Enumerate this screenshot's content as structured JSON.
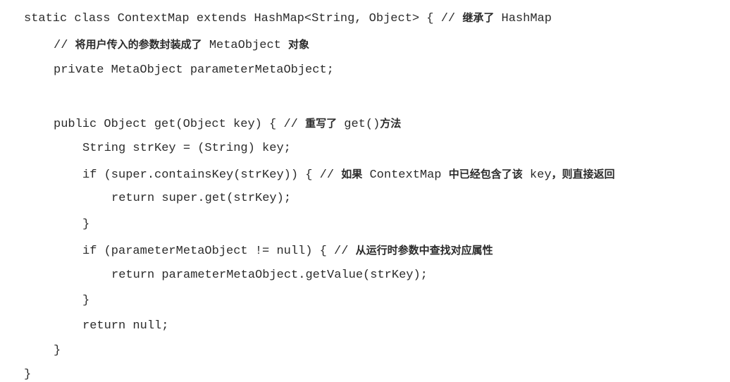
{
  "code_lines": [
    "static class ContextMap extends HashMap<String, Object> { // 继承了 HashMap",
    "// 将用户传入的参数封装成了 MetaObject 对象",
    "private MetaObject parameterMetaObject;",
    "",
    "public Object get(Object key) { // 重写了 get()方法",
    "String strKey = (String) key;",
    "if (super.containsKey(strKey)) { // 如果 ContextMap 中已经包含了该 key，则直接返回",
    "return super.get(strKey);",
    "}",
    "if (parameterMetaObject != null) { // 从运行时参数中查找对应属性",
    "return parameterMetaObject.getValue(strKey);",
    "}",
    "return null;",
    "}",
    "}"
  ]
}
